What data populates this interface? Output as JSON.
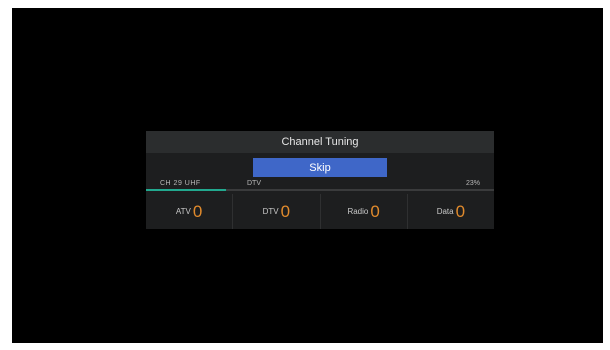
{
  "dialog": {
    "title": "Channel Tuning",
    "skip_label": "Skip",
    "channel_label": "CH  29  UHF",
    "signal_type": "DTV",
    "progress_text": "23%",
    "progress_fraction": 0.23
  },
  "counts": [
    {
      "label": "ATV",
      "value": "0"
    },
    {
      "label": "DTV",
      "value": "0"
    },
    {
      "label": "Radio",
      "value": "0"
    },
    {
      "label": "Data",
      "value": "0"
    }
  ],
  "colors": {
    "accent": "#3f67c8",
    "count_value": "#e08a2c",
    "progress": "#22a98f"
  }
}
